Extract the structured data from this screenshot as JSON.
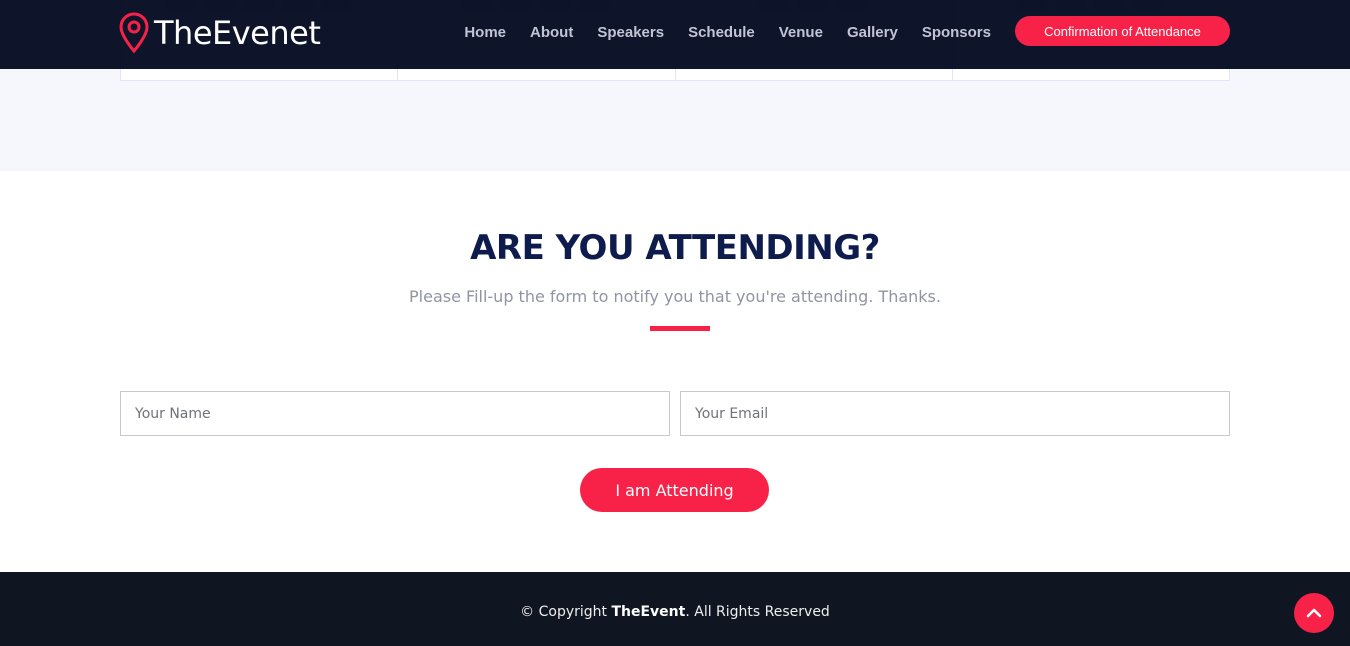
{
  "header": {
    "brand": "TheEvenet",
    "nav": [
      "Home",
      "About",
      "Speakers",
      "Schedule",
      "Venue",
      "Gallery",
      "Sponsors"
    ],
    "cta_label": "Confirmation of Attendance"
  },
  "attend": {
    "title": "ARE YOU ATTENDING?",
    "subtitle": "Please Fill-up the form to notify you that you're attending. Thanks.",
    "name_placeholder": "Your Name",
    "email_placeholder": "Your Email",
    "submit_label": "I am Attending"
  },
  "footer": {
    "copyright_prefix": "© Copyright",
    "brand": "TheEvent",
    "copyright_suffix": ". All Rights Reserved"
  },
  "icons": {
    "logo": "map-pin-icon",
    "back_to_top": "chevron-up-icon"
  },
  "colors": {
    "accent": "#f82249",
    "header_bg": "#060c22",
    "title": "#0e1b4d",
    "footer_bg": "#101522"
  }
}
